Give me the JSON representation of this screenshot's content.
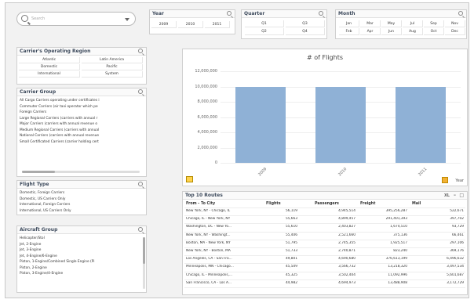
{
  "search": {
    "placeholder": "Search"
  },
  "year": {
    "title": "Year",
    "values": [
      "2009",
      "2010",
      "2011"
    ]
  },
  "quarter": {
    "title": "Quarter",
    "values": [
      "Q1",
      "Q3",
      "Q2",
      "Q4"
    ]
  },
  "month": {
    "title": "Month",
    "values": [
      "Jan",
      "Mar",
      "May",
      "Jul",
      "Sep",
      "Nov",
      "Feb",
      "Apr",
      "Jun",
      "Aug",
      "Oct",
      "Dec"
    ]
  },
  "regions": {
    "title": "Carrier's Operating Region",
    "values": [
      "Atlantic",
      "Latin America",
      "Domestic",
      "Pacific",
      "International",
      "System"
    ]
  },
  "carrier_group": {
    "title": "Carrier Group",
    "values": [
      "All Cargo Carriers operating under certificates i",
      "Commuter Carriers (air taxi operator which pe",
      "Foreign Carriers",
      "Large Regional Carriers (carriers with annual r",
      "Major Carriers (carriers with annual revenue o",
      "Medium Regional Carriers (carriers with annual",
      "National Carriers (carriers with annual revenue",
      "Small Certificated Carriers (carrier holding cert"
    ]
  },
  "flight_type": {
    "title": "Flight Type",
    "values": [
      "Domestic, Foreign Carriers",
      "Domestic, US Carriers Only",
      "International, Foreign Carriers",
      "International, US Carriers Only"
    ]
  },
  "aircraft_group": {
    "title": "Aircraft Group",
    "values": [
      "Helicopter/Stol",
      "Jet, 2-Engine",
      "Jet, 3-Engine",
      "Jet, 4-Engine/6-Engine",
      "Piston, 1-Engine/Combined Single Engine (Pi",
      "Piston, 2-Engine",
      "Piston, 3-Engine/4-Engine"
    ]
  },
  "chart_data": {
    "type": "bar",
    "title": "# of Flights",
    "categories": [
      "2009",
      "2010",
      "2011"
    ],
    "values": [
      10000000,
      10000000,
      10000000
    ],
    "ylim": [
      0,
      12000000
    ],
    "yticks": [
      "0",
      "2,000,000",
      "4,000,000",
      "6,000,000",
      "8,000,000",
      "10,000,000",
      "12,000,000"
    ],
    "xlabel": "Year"
  },
  "routes": {
    "title": "Top 10 Routes",
    "headers": [
      "From - To City",
      "Flights",
      "Passengers",
      "Freight",
      "Mail"
    ],
    "rows": [
      [
        "New York, NY - Chicago, IL",
        "56,119",
        "4,945,514",
        "395,256,287",
        "522,671"
      ],
      [
        "Chicago, IL - New York, NY",
        "55,663",
        "4,899,457",
        "291,401,393",
        "397,702"
      ],
      [
        "Washington, DC - New Yo...",
        "55,610",
        "2,403,827",
        "1,674,510",
        "93,729"
      ],
      [
        "New York, NY - Washingt...",
        "55,406",
        "2,521,660",
        "375,136",
        "66,461"
      ],
      [
        "Boston, MA - New York, NY",
        "51,795",
        "2,745,355",
        "1,925,517",
        "297,106"
      ],
      [
        "New York, NY - Boston, MA",
        "51,733",
        "2,740,871",
        "823,240",
        "369,176"
      ],
      [
        "Los Angeles, CA - San Fra...",
        "49,801",
        "4,690,680",
        "376,613,199",
        "6,496,632"
      ],
      [
        "Minneapolis, MN - Chicago...",
        "45,509",
        "3,566,732",
        "13,218,320",
        "3,497,534"
      ],
      [
        "Chicago, IL - Minneapolis,...",
        "45,325",
        "3,502,404",
        "11,092,996",
        "5,601,687"
      ],
      [
        "San Francisco, CA - Los A...",
        "44,982",
        "4,694,973",
        "13,488,908",
        "3,172,729"
      ]
    ]
  },
  "table_controls": {
    "xl": "XL",
    "min": "–",
    "max": "□"
  }
}
